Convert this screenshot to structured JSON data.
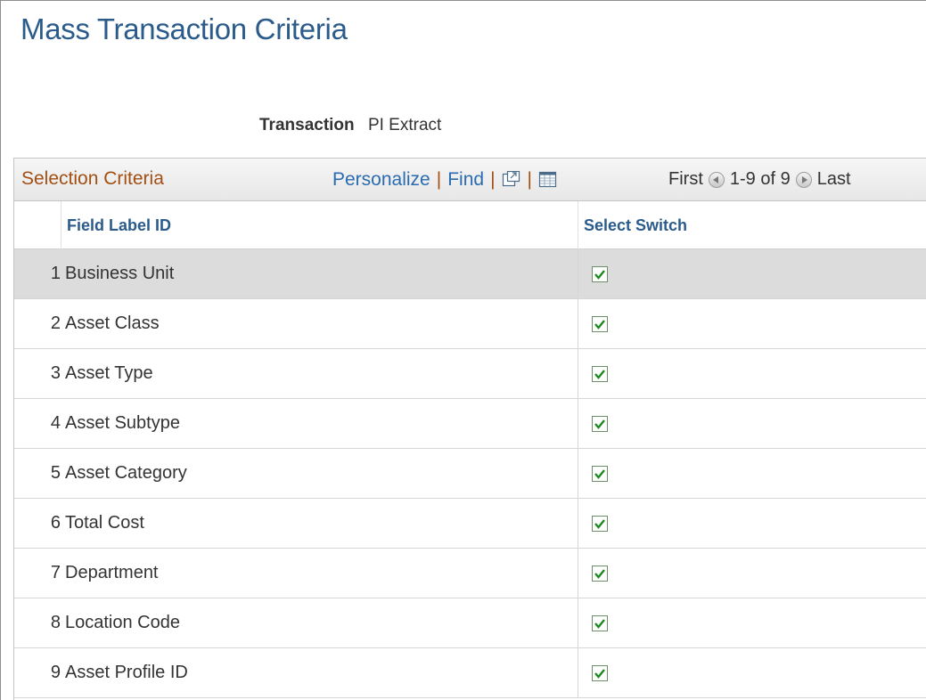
{
  "page": {
    "title": "Mass Transaction Criteria",
    "transaction_label": "Transaction",
    "transaction_value": "PI Extract"
  },
  "grid": {
    "title": "Selection Criteria",
    "personalize_label": "Personalize",
    "find_label": "Find",
    "separator": "|",
    "zoom_icon": "view-all-icon",
    "download_icon": "download-spreadsheet-icon",
    "pager": {
      "first_label": "First",
      "range_text": "1-9 of 9",
      "last_label": "Last"
    },
    "columns": {
      "field_label": "Field Label ID",
      "select_switch": "Select Switch"
    },
    "rows": [
      {
        "num": "1",
        "label": "Business Unit",
        "checked": true
      },
      {
        "num": "2",
        "label": "Asset Class",
        "checked": true
      },
      {
        "num": "3",
        "label": "Asset Type",
        "checked": true
      },
      {
        "num": "4",
        "label": "Asset Subtype",
        "checked": true
      },
      {
        "num": "5",
        "label": "Asset Category",
        "checked": true
      },
      {
        "num": "6",
        "label": "Total Cost",
        "checked": true
      },
      {
        "num": "7",
        "label": "Department",
        "checked": true
      },
      {
        "num": "8",
        "label": "Location Code",
        "checked": true
      },
      {
        "num": "9",
        "label": "Asset Profile ID",
        "checked": true
      }
    ]
  },
  "colors": {
    "title": "#2b5b8a",
    "grid_title": "#a24f14",
    "link": "#2b6cb0",
    "checkmark": "#1e8a1e",
    "selected_row": "#dcdcdc"
  }
}
